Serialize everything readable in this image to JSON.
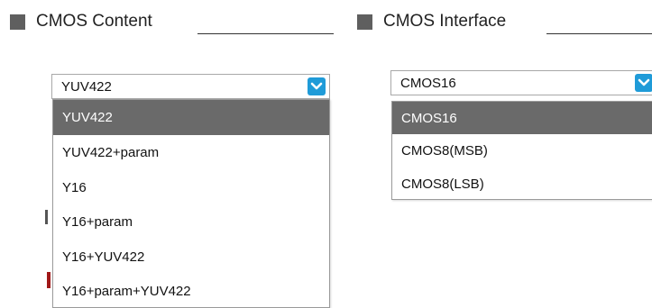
{
  "sections": {
    "content": {
      "title": "CMOS Content",
      "combo": {
        "selected": "YUV422",
        "options": [
          "YUV422",
          "YUV422+param",
          "Y16",
          "Y16+param",
          "Y16+YUV422",
          "Y16+param+YUV422"
        ],
        "highlighted_index": 0
      }
    },
    "interface": {
      "title": "CMOS Interface",
      "combo": {
        "selected": "CMOS16",
        "options": [
          "CMOS16",
          "CMOS8(MSB)",
          "CMOS8(LSB)"
        ],
        "highlighted_index": 0
      }
    }
  },
  "icons": {
    "section_marker": "square-icon",
    "dropdown_arrow": "chevron-down-icon"
  },
  "colors": {
    "section_marker": "#5f5f5f",
    "arrow_button": "#1f9bd8",
    "highlight": "#6a6a6a"
  }
}
